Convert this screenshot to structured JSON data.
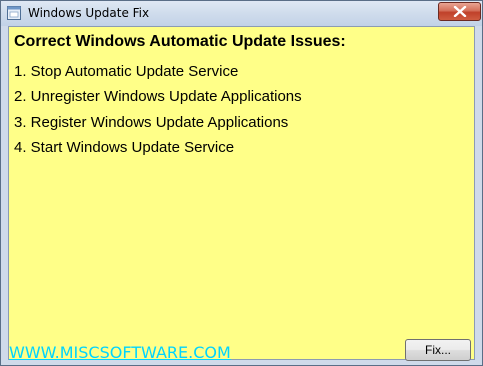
{
  "window": {
    "title": "Windows Update Fix"
  },
  "main": {
    "heading": "Correct Windows Automatic Update Issues:",
    "steps": [
      "1. Stop Automatic Update Service",
      "2. Unregister Windows Update Applications",
      "3. Register Windows Update Applications",
      "4. Start Windows Update Service"
    ],
    "link_text": "WWW.MISCSOFTWARE.COM",
    "fix_button_label": "Fix..."
  },
  "icons": {
    "app": "app-icon",
    "close": "close-icon"
  },
  "colors": {
    "background": "#ffff88",
    "link": "#00d4ff",
    "close_button": "#c0412a"
  }
}
